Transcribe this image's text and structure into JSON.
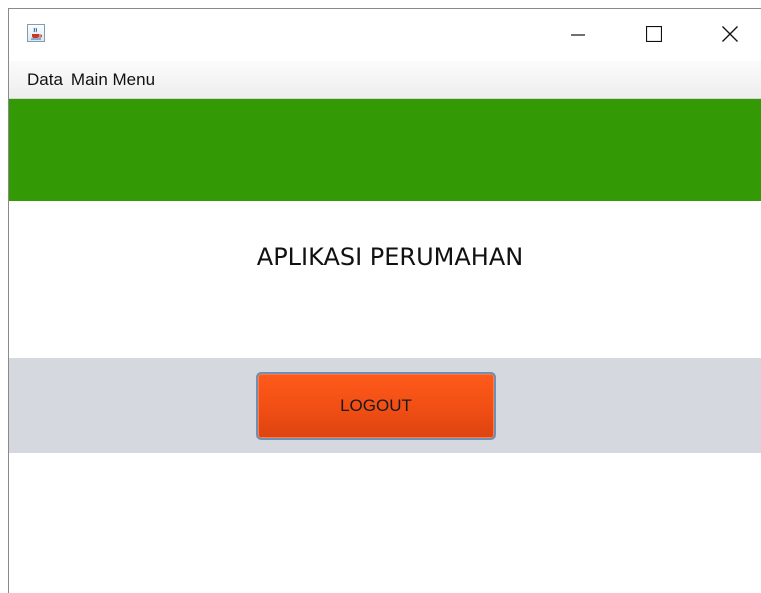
{
  "window": {
    "icon": "java-cup-icon",
    "controls": [
      "minimize",
      "maximize",
      "close"
    ]
  },
  "menubar": {
    "items": [
      {
        "label": "Data"
      },
      {
        "label": "Main Menu"
      }
    ]
  },
  "main": {
    "title": "APLIKASI PERUMAHAN",
    "logout_label": "LOGOUT"
  },
  "colors": {
    "header_band": "#339904",
    "action_band": "#d5d8de",
    "logout_button": "#f04e14"
  }
}
